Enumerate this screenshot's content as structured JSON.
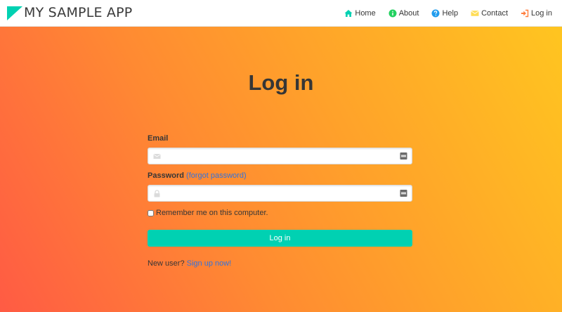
{
  "brand": {
    "title": "MY SAMPLE APP",
    "logo_color": "#00d1b2"
  },
  "nav": {
    "items": [
      {
        "label": "Home",
        "icon": "home-icon",
        "color": "#00d1b2"
      },
      {
        "label": "About",
        "icon": "info-icon",
        "color": "#23d160"
      },
      {
        "label": "Help",
        "icon": "question-icon",
        "color": "#209cee"
      },
      {
        "label": "Contact",
        "icon": "envelope-icon",
        "color": "#ffdd57"
      },
      {
        "label": "Log in",
        "icon": "sign-in-icon",
        "color": "#ff7f3f"
      }
    ]
  },
  "login": {
    "title": "Log in",
    "email_label": "Email",
    "email_value": "",
    "password_label": "Password",
    "forgot_label": "(forgot password)",
    "password_value": "",
    "remember_label": "Remember me on this computer.",
    "remember_checked": false,
    "submit_label": "Log in",
    "new_user_text": "New user?",
    "signup_label": "Sign up now!"
  },
  "colors": {
    "primary": "#00d1b2",
    "link": "#3273dc",
    "gradient_start": "#ff5b44",
    "gradient_end": "#ffc520"
  }
}
